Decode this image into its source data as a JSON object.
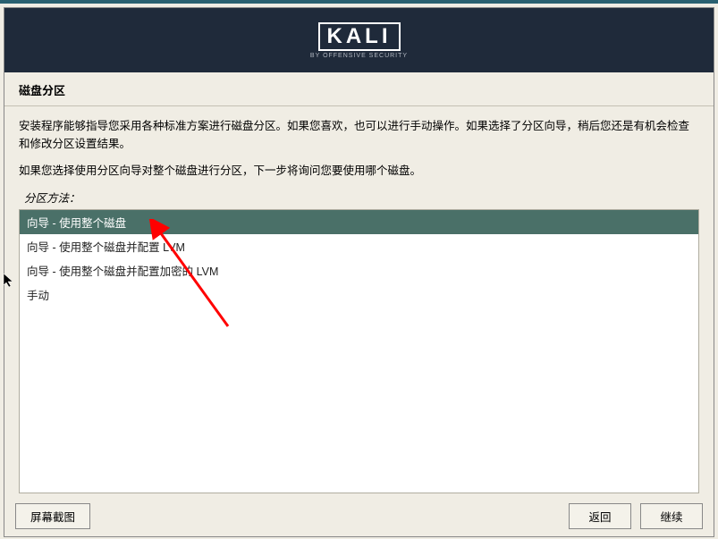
{
  "header": {
    "logo_text": "KALI",
    "logo_subtitle": "BY OFFENSIVE SECURITY"
  },
  "page": {
    "title": "磁盘分区",
    "description1": "安装程序能够指导您采用各种标准方案进行磁盘分区。如果您喜欢，也可以进行手动操作。如果选择了分区向导，稍后您还是有机会检查和修改分区设置结果。",
    "description2": "如果您选择使用分区向导对整个磁盘进行分区，下一步将询问您要使用哪个磁盘。",
    "section_label": "分区方法："
  },
  "options": [
    "向导 - 使用整个磁盘",
    "向导 - 使用整个磁盘并配置 LVM",
    "向导 - 使用整个磁盘并配置加密的 LVM",
    "手动"
  ],
  "selected_index": 0,
  "buttons": {
    "screenshot": "屏幕截图",
    "back": "返回",
    "continue": "继续"
  }
}
